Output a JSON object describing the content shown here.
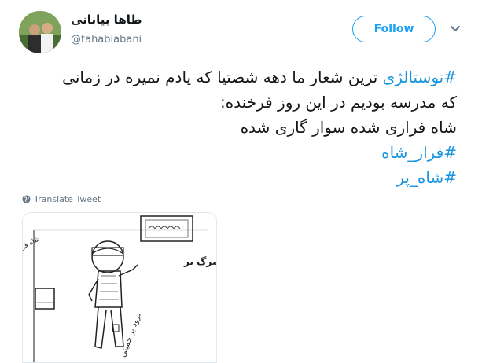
{
  "header": {
    "display_name": "طاها بیابانی",
    "handle": "@tahabiabani",
    "follow_label": "Follow"
  },
  "tweet": {
    "line1_hashtag": "#نوستالژی",
    "line1_rest": " ترین شعار ما دهه شصتیا که یادم نمیره در زمانی",
    "line2": "که مدرسه بودیم در این روز فرخنده:",
    "line3": "شاه فراری شده سوار گاری شده",
    "hashtag2": "#فرار_شاه",
    "hashtag3": "#شاه_پر"
  },
  "translate_label": "Translate Tweet",
  "media": {
    "text_left": "شاه فراری شده سوار گاری شده",
    "text_wall": "مرگ بر",
    "text_bottom": "درود بر خمینی"
  },
  "colors": {
    "accent": "#1da1f2",
    "hashtag": "#1b95e0",
    "muted": "#657786"
  },
  "icons": [
    "avatar",
    "chevron-down-icon",
    "globe-icon"
  ]
}
